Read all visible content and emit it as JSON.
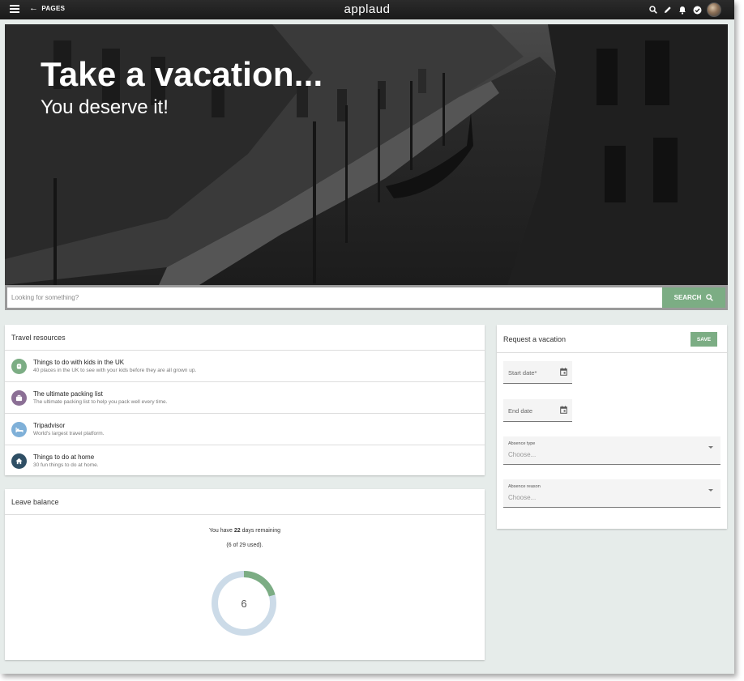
{
  "topbar": {
    "back_label": "PAGES",
    "brand": "applaud"
  },
  "hero": {
    "title": "Take a vacation...",
    "subtitle": "You deserve it!"
  },
  "search": {
    "placeholder": "Looking for something?",
    "button_label": "SEARCH"
  },
  "travel_resources": {
    "title": "Travel resources",
    "items": [
      {
        "name": "Things to do with kids in the UK",
        "description": "40 places in the UK to see with your kids before they are all grown up.",
        "icon": "child-icon",
        "color": "#7cad84"
      },
      {
        "name": "The ultimate packing list",
        "description": "The ultimate packing list to help you pack well every time.",
        "icon": "suitcase-icon",
        "color": "#8b6f95"
      },
      {
        "name": "Tripadvisor",
        "description": "World's largest travel platform.",
        "icon": "bed-icon",
        "color": "#7fb0d8"
      },
      {
        "name": "Things to do at home",
        "description": "30 fun things to do at home.",
        "icon": "home-icon",
        "color": "#2f4f65"
      }
    ]
  },
  "leave_balance": {
    "title": "Leave balance",
    "text_before": "You have ",
    "days_remaining": "22",
    "text_after": " days remaining",
    "used_text": "(6 of 29 used).",
    "used": 6,
    "total": 29,
    "ring_label": "6",
    "ring_color": "#7cad84",
    "track_color": "#ccdbe8"
  },
  "request_vacation": {
    "title": "Request a vacation",
    "save_label": "SAVE",
    "start_date_label": "Start date*",
    "end_date_label": "End date",
    "absence_type_label": "Absence type",
    "absence_type_value": "Choose...",
    "absence_reason_label": "Absence reason",
    "absence_reason_value": "Choose..."
  }
}
